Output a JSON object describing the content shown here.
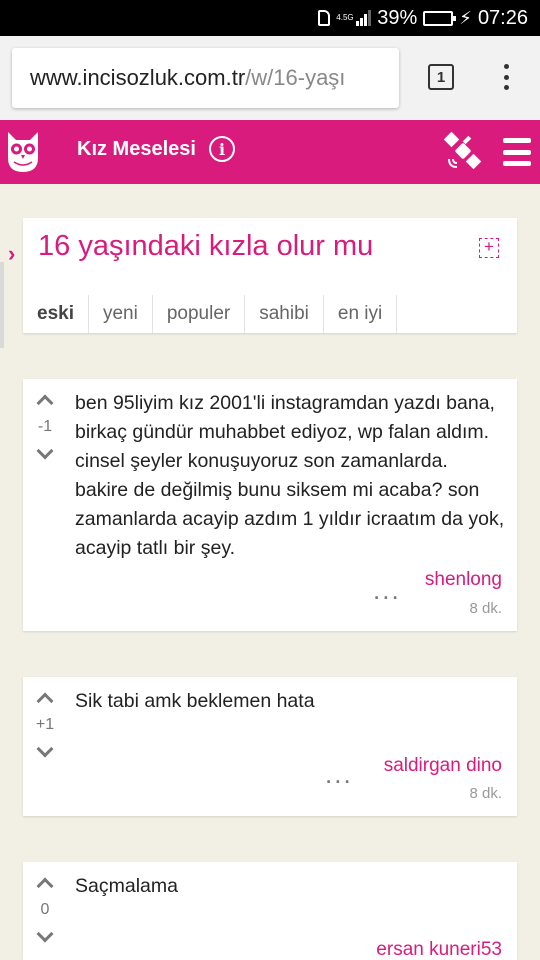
{
  "status_bar": {
    "battery": "39%",
    "battery_level": 0.39,
    "network": "4.5G",
    "time": "07:26",
    "icons": [
      "sim-card-icon",
      "signal-icon",
      "battery-icon",
      "charging-icon"
    ]
  },
  "browser": {
    "url_host": "www.incisozluk.com.tr",
    "url_path": "/w/16-yaşı",
    "tab_count": "1"
  },
  "site": {
    "section_title": "Kız Meselesi",
    "info_glyph": "i",
    "brand_color": "#d81b7d"
  },
  "topic": {
    "title": "16 yaşındaki kızla olur mu",
    "sort_tabs": [
      "eski",
      "yeni",
      "populer",
      "sahibi",
      "en iyi"
    ],
    "active_tab": "eski",
    "chevron": "›",
    "plus": "+"
  },
  "entries": [
    {
      "score": "-1",
      "text": "ben 95liyim kız 2001'li instagramdan yazdı bana, birkaç gündür muhabbet ediyoz, wp falan aldım. cinsel şeyler konuşuyoruz son zamanlarda. bakire de değilmiş bunu siksem mi acaba? son zamanlarda acayip azdım 1 yıldır icraatım da yok, acayip tatlı bir şey.",
      "author": "shenlong",
      "time": "8 dk.",
      "more": "..."
    },
    {
      "score": "+1",
      "text": "Sik tabi amk beklemen hata",
      "author": "saldirgan dino",
      "time": "8 dk.",
      "more": "..."
    },
    {
      "score": "0",
      "text": "Saçmalama",
      "author": "ersan kuneri53",
      "time": "",
      "more": "..."
    }
  ]
}
